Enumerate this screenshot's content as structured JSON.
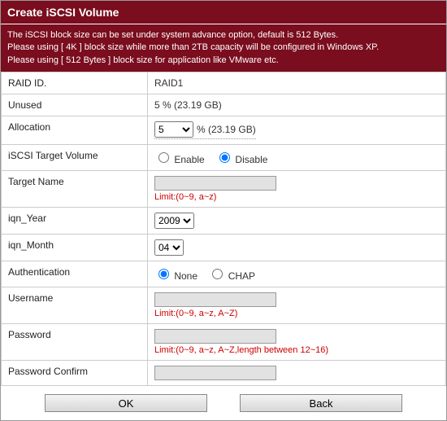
{
  "title": "Create iSCSI Volume",
  "info_lines": [
    "The iSCSI block size can be set under system advance option, default is 512 Bytes.",
    "Please using [ 4K ] block size while more than 2TB capacity will be configured in Windows XP.",
    "Please using [ 512 Bytes ] block size for application like VMware etc."
  ],
  "labels": {
    "raid_id": "RAID ID.",
    "unused": "Unused",
    "allocation": "Allocation",
    "target_volume": "iSCSI Target Volume",
    "target_name": "Target Name",
    "iqn_year": "iqn_Year",
    "iqn_month": "iqn_Month",
    "authentication": "Authentication",
    "username": "Username",
    "password": "Password",
    "password_confirm": "Password Confirm"
  },
  "values": {
    "raid_id": "RAID1",
    "unused": "5 % (23.19 GB)",
    "allocation_selected": "5",
    "allocation_suffix": "% (23.19 GB)",
    "target_volume": "Disable",
    "target_volume_options": {
      "enable": "Enable",
      "disable": "Disable"
    },
    "target_name": "",
    "iqn_year": "2009",
    "iqn_month": "04",
    "authentication": "None",
    "auth_options": {
      "none": "None",
      "chap": "CHAP"
    },
    "username": "",
    "password": "",
    "password_confirm": ""
  },
  "hints": {
    "target_name": "Limit:(0~9, a~z)",
    "username": "Limit:(0~9, a~z, A~Z)",
    "password": "Limit:(0~9, a~z, A~Z,length between 12~16)"
  },
  "buttons": {
    "ok": "OK",
    "back": "Back"
  }
}
